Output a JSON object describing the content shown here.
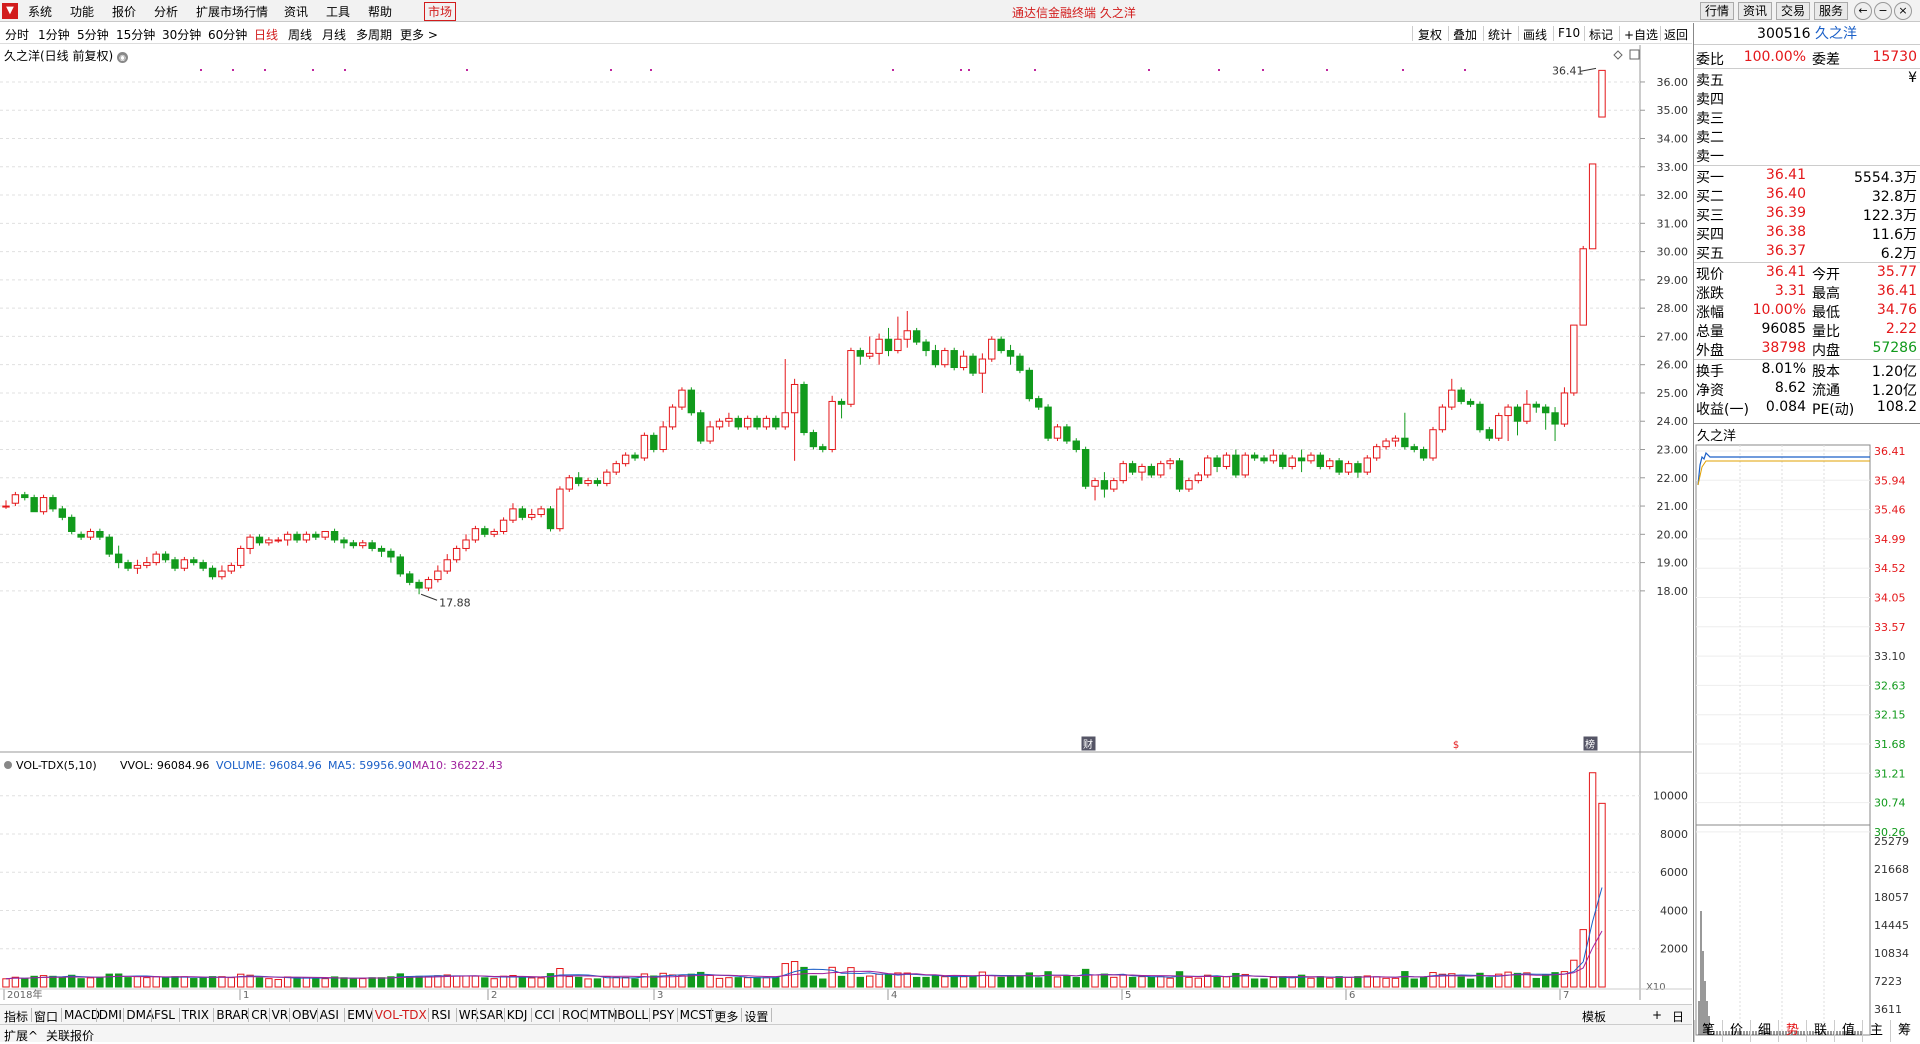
{
  "menu": {
    "items": [
      "系统",
      "功能",
      "报价",
      "分析",
      "扩展市场行情",
      "资讯",
      "工具",
      "帮助",
      "市场"
    ],
    "app_title": "通达信金融终端 久之洋",
    "right_buttons": [
      "行情",
      "资讯",
      "交易",
      "服务"
    ]
  },
  "periods": [
    "分时",
    "1分钟",
    "5分钟",
    "15分钟",
    "30分钟",
    "60分钟",
    "日线",
    "周线",
    "月线",
    "多周期",
    "更多 >"
  ],
  "active_period": "日线",
  "tools": [
    "复权",
    "叠加",
    "统计",
    "画线",
    "F10",
    "标记",
    "+自选",
    "返回"
  ],
  "chart": {
    "title": "久之洋(日线 前复权)",
    "price_axis": [
      "36.00",
      "35.00",
      "34.00",
      "33.00",
      "32.00",
      "31.00",
      "30.00",
      "29.00",
      "28.00",
      "27.00",
      "26.00",
      "25.00",
      "24.00",
      "23.00",
      "22.00",
      "21.00",
      "20.00",
      "19.00",
      "18.00"
    ],
    "high_label": "36.41",
    "low_label": "17.88",
    "date_labels": [
      "2018年",
      "1",
      "2",
      "3",
      "4",
      "5",
      "6",
      "7"
    ],
    "markers": [
      "财",
      "$",
      "榜"
    ],
    "colors": {
      "up": "#e4171a",
      "down": "#119a1c",
      "ma5": "#1a5fc7",
      "ma10": "#a0239e"
    }
  },
  "chart_data": {
    "type": "candlestick",
    "title": "久之洋(日线 前复权)",
    "ylim": [
      17.5,
      36.6
    ],
    "ohlc": [
      [
        21.0,
        21.2,
        20.9,
        21.0
      ],
      [
        21.1,
        21.5,
        21.0,
        21.4
      ],
      [
        21.4,
        21.5,
        21.2,
        21.3
      ],
      [
        21.3,
        21.4,
        20.8,
        20.8
      ],
      [
        20.8,
        21.4,
        20.7,
        21.3
      ],
      [
        21.3,
        21.4,
        20.8,
        20.9
      ],
      [
        20.9,
        21.0,
        20.5,
        20.6
      ],
      [
        20.6,
        20.7,
        20.0,
        20.1
      ],
      [
        20.0,
        20.1,
        19.8,
        19.9
      ],
      [
        19.9,
        20.2,
        19.8,
        20.1
      ],
      [
        20.1,
        20.2,
        19.8,
        19.9
      ],
      [
        19.9,
        20.0,
        19.2,
        19.3
      ],
      [
        19.3,
        19.6,
        18.8,
        19.0
      ],
      [
        19.0,
        19.1,
        18.7,
        18.8
      ],
      [
        18.8,
        19.1,
        18.6,
        18.9
      ],
      [
        18.9,
        19.2,
        18.8,
        19.0
      ],
      [
        19.0,
        19.4,
        18.9,
        19.3
      ],
      [
        19.3,
        19.4,
        19.0,
        19.1
      ],
      [
        19.1,
        19.2,
        18.7,
        18.8
      ],
      [
        18.8,
        19.2,
        18.7,
        19.1
      ],
      [
        19.1,
        19.2,
        18.9,
        19.0
      ],
      [
        19.0,
        19.1,
        18.7,
        18.8
      ],
      [
        18.8,
        18.9,
        18.4,
        18.5
      ],
      [
        18.5,
        18.9,
        18.4,
        18.7
      ],
      [
        18.7,
        19.0,
        18.6,
        18.9
      ],
      [
        18.9,
        19.6,
        18.8,
        19.5
      ],
      [
        19.5,
        20.0,
        19.3,
        19.9
      ],
      [
        19.9,
        20.0,
        19.6,
        19.7
      ],
      [
        19.7,
        19.9,
        19.6,
        19.8
      ],
      [
        19.8,
        19.9,
        19.7,
        19.8
      ],
      [
        19.8,
        20.1,
        19.6,
        20.0
      ],
      [
        20.0,
        20.1,
        19.7,
        19.8
      ],
      [
        19.8,
        20.1,
        19.7,
        20.0
      ],
      [
        20.0,
        20.1,
        19.8,
        19.9
      ],
      [
        19.9,
        20.1,
        19.8,
        20.1
      ],
      [
        20.1,
        20.2,
        19.7,
        19.8
      ],
      [
        19.8,
        19.9,
        19.5,
        19.7
      ],
      [
        19.7,
        19.8,
        19.5,
        19.6
      ],
      [
        19.6,
        19.8,
        19.5,
        19.7
      ],
      [
        19.7,
        19.8,
        19.4,
        19.5
      ],
      [
        19.5,
        19.6,
        19.2,
        19.4
      ],
      [
        19.4,
        19.5,
        19.0,
        19.2
      ],
      [
        19.2,
        19.3,
        18.5,
        18.6
      ],
      [
        18.6,
        18.7,
        18.2,
        18.3
      ],
      [
        18.3,
        18.4,
        17.88,
        18.1
      ],
      [
        18.1,
        18.5,
        18.0,
        18.4
      ],
      [
        18.4,
        18.9,
        18.3,
        18.7
      ],
      [
        18.7,
        19.3,
        18.6,
        19.1
      ],
      [
        19.1,
        19.6,
        19.0,
        19.5
      ],
      [
        19.5,
        20.0,
        19.4,
        19.8
      ],
      [
        19.8,
        20.3,
        19.7,
        20.2
      ],
      [
        20.2,
        20.3,
        19.9,
        20.0
      ],
      [
        20.0,
        20.2,
        19.9,
        20.1
      ],
      [
        20.1,
        20.6,
        20.0,
        20.5
      ],
      [
        20.5,
        21.1,
        20.4,
        20.9
      ],
      [
        20.9,
        21.0,
        20.5,
        20.6
      ],
      [
        20.6,
        20.9,
        20.5,
        20.7
      ],
      [
        20.7,
        21.0,
        20.6,
        20.9
      ],
      [
        20.9,
        21.0,
        20.1,
        20.2
      ],
      [
        20.2,
        21.7,
        20.1,
        21.6
      ],
      [
        21.6,
        22.1,
        21.5,
        22.0
      ],
      [
        22.0,
        22.2,
        21.7,
        21.8
      ],
      [
        21.8,
        22.0,
        21.7,
        21.9
      ],
      [
        21.9,
        22.0,
        21.7,
        21.8
      ],
      [
        21.8,
        22.3,
        21.7,
        22.2
      ],
      [
        22.2,
        22.6,
        22.1,
        22.5
      ],
      [
        22.5,
        22.9,
        22.4,
        22.8
      ],
      [
        22.8,
        22.9,
        22.6,
        22.7
      ],
      [
        22.7,
        23.6,
        22.6,
        23.5
      ],
      [
        23.5,
        23.6,
        22.9,
        23.0
      ],
      [
        23.0,
        24.0,
        22.9,
        23.8
      ],
      [
        23.8,
        24.6,
        23.7,
        24.5
      ],
      [
        24.5,
        25.2,
        24.4,
        25.1
      ],
      [
        25.1,
        25.2,
        24.2,
        24.3
      ],
      [
        24.3,
        24.4,
        23.2,
        23.3
      ],
      [
        23.3,
        24.0,
        23.2,
        23.8
      ],
      [
        23.8,
        24.1,
        23.7,
        24.0
      ],
      [
        24.0,
        24.3,
        23.8,
        24.1
      ],
      [
        24.1,
        24.2,
        23.7,
        23.8
      ],
      [
        23.8,
        24.2,
        23.7,
        24.1
      ],
      [
        24.1,
        24.2,
        23.7,
        23.8
      ],
      [
        23.8,
        24.2,
        23.7,
        24.1
      ],
      [
        24.1,
        24.2,
        23.7,
        23.8
      ],
      [
        23.8,
        26.2,
        23.7,
        24.3
      ],
      [
        24.3,
        25.5,
        22.6,
        25.3
      ],
      [
        25.3,
        25.4,
        23.5,
        23.6
      ],
      [
        23.6,
        23.7,
        23.0,
        23.1
      ],
      [
        23.1,
        23.2,
        22.9,
        23.0
      ],
      [
        23.0,
        24.9,
        22.9,
        24.7
      ],
      [
        24.7,
        24.8,
        24.1,
        24.6
      ],
      [
        24.6,
        26.6,
        24.5,
        26.5
      ],
      [
        26.5,
        26.6,
        26.0,
        26.3
      ],
      [
        26.3,
        27.0,
        26.2,
        26.4
      ],
      [
        26.4,
        27.1,
        26.0,
        26.9
      ],
      [
        26.9,
        27.3,
        26.3,
        26.5
      ],
      [
        26.5,
        27.7,
        26.4,
        26.9
      ],
      [
        26.9,
        27.9,
        26.6,
        27.2
      ],
      [
        27.2,
        27.3,
        26.7,
        26.8
      ],
      [
        26.8,
        26.9,
        26.3,
        26.5
      ],
      [
        26.5,
        26.7,
        25.9,
        26.0
      ],
      [
        26.0,
        26.6,
        25.9,
        26.5
      ],
      [
        26.5,
        26.6,
        25.8,
        25.9
      ],
      [
        25.9,
        26.5,
        25.8,
        26.3
      ],
      [
        26.3,
        26.4,
        25.6,
        25.7
      ],
      [
        25.7,
        26.4,
        25.0,
        26.2
      ],
      [
        26.2,
        27.0,
        26.1,
        26.9
      ],
      [
        26.9,
        27.0,
        26.4,
        26.5
      ],
      [
        26.5,
        26.7,
        26.0,
        26.3
      ],
      [
        26.3,
        26.4,
        25.7,
        25.8
      ],
      [
        25.8,
        25.9,
        24.7,
        24.8
      ],
      [
        24.8,
        24.9,
        24.4,
        24.5
      ],
      [
        24.5,
        24.6,
        23.3,
        23.4
      ],
      [
        23.4,
        23.9,
        23.3,
        23.8
      ],
      [
        23.8,
        23.9,
        23.2,
        23.3
      ],
      [
        23.3,
        23.4,
        22.9,
        23.0
      ],
      [
        23.0,
        23.1,
        21.6,
        21.7
      ],
      [
        21.7,
        22.0,
        21.2,
        21.9
      ],
      [
        21.9,
        22.2,
        21.3,
        21.6
      ],
      [
        21.6,
        22.0,
        21.5,
        21.9
      ],
      [
        21.9,
        22.6,
        21.8,
        22.5
      ],
      [
        22.5,
        22.6,
        22.1,
        22.2
      ],
      [
        22.2,
        22.5,
        21.9,
        22.4
      ],
      [
        22.4,
        22.5,
        22.0,
        22.1
      ],
      [
        22.1,
        22.6,
        22.0,
        22.5
      ],
      [
        22.5,
        22.7,
        22.3,
        22.6
      ],
      [
        22.6,
        22.7,
        21.5,
        21.6
      ],
      [
        21.6,
        22.0,
        21.5,
        21.9
      ],
      [
        21.9,
        22.2,
        21.8,
        22.1
      ],
      [
        22.1,
        22.8,
        22.0,
        22.7
      ],
      [
        22.7,
        22.8,
        22.2,
        22.4
      ],
      [
        22.4,
        22.9,
        22.3,
        22.8
      ],
      [
        22.8,
        23.0,
        22.0,
        22.1
      ],
      [
        22.1,
        22.9,
        22.0,
        22.8
      ],
      [
        22.8,
        22.9,
        22.6,
        22.7
      ],
      [
        22.7,
        22.8,
        22.5,
        22.6
      ],
      [
        22.6,
        23.0,
        22.5,
        22.8
      ],
      [
        22.8,
        22.9,
        22.3,
        22.4
      ],
      [
        22.4,
        22.8,
        22.3,
        22.7
      ],
      [
        22.7,
        23.0,
        22.2,
        22.6
      ],
      [
        22.6,
        22.9,
        22.5,
        22.8
      ],
      [
        22.8,
        22.9,
        22.3,
        22.4
      ],
      [
        22.4,
        22.7,
        22.3,
        22.6
      ],
      [
        22.6,
        22.7,
        22.1,
        22.2
      ],
      [
        22.2,
        22.6,
        22.1,
        22.5
      ],
      [
        22.5,
        22.6,
        22.0,
        22.2
      ],
      [
        22.2,
        22.8,
        22.1,
        22.7
      ],
      [
        22.7,
        23.2,
        22.6,
        23.1
      ],
      [
        23.1,
        23.4,
        23.0,
        23.3
      ],
      [
        23.3,
        23.5,
        23.1,
        23.4
      ],
      [
        23.4,
        24.3,
        23.0,
        23.1
      ],
      [
        23.1,
        23.2,
        22.9,
        23.0
      ],
      [
        23.0,
        23.1,
        22.6,
        22.7
      ],
      [
        22.7,
        23.8,
        22.6,
        23.7
      ],
      [
        23.7,
        24.6,
        23.6,
        24.5
      ],
      [
        24.5,
        25.5,
        24.4,
        25.1
      ],
      [
        25.1,
        25.2,
        24.6,
        24.7
      ],
      [
        24.7,
        24.8,
        24.5,
        24.6
      ],
      [
        24.6,
        24.7,
        23.6,
        23.7
      ],
      [
        23.7,
        23.8,
        23.3,
        23.4
      ],
      [
        23.4,
        24.3,
        23.3,
        24.2
      ],
      [
        24.2,
        24.6,
        23.3,
        24.5
      ],
      [
        24.5,
        24.6,
        23.5,
        24.0
      ],
      [
        24.0,
        25.1,
        23.9,
        24.6
      ],
      [
        24.6,
        24.7,
        24.3,
        24.5
      ],
      [
        24.5,
        24.6,
        23.7,
        24.3
      ],
      [
        24.3,
        24.5,
        23.3,
        23.9
      ],
      [
        23.9,
        25.2,
        23.8,
        25.0
      ],
      [
        25.0,
        27.0,
        24.9,
        27.4
      ],
      [
        27.4,
        30.2,
        27.4,
        30.1
      ],
      [
        30.1,
        33.1,
        30.1,
        33.1
      ],
      [
        34.76,
        36.41,
        34.76,
        36.41
      ]
    ],
    "volume_axis": [
      "10000",
      "8000",
      "6000",
      "4000",
      "2000"
    ],
    "volume_note": "VOL-TDX(5,10) VVOL: 96084.96 VOLUME: 96084.96 MA5: 59956.90 MA10: 36222.43"
  },
  "volume": {
    "legend_name": "VOL-TDX(5,10)",
    "vvol": "VVOL: 96084.96",
    "volume": "VOLUME: 96084.96",
    "ma5": "MA5: 59956.90",
    "ma10": "MA10: 36222.43",
    "axis": [
      "10000",
      "8000",
      "6000",
      "4000",
      "2000"
    ],
    "x10": "X10"
  },
  "indicators": [
    "指标",
    "窗口",
    "MACD",
    "DMI",
    "DMA",
    "FSL",
    "TRIX",
    "BRAR",
    "CR",
    "VR",
    "OBV",
    "ASI",
    "EMV",
    "VOL-TDX",
    "RSI",
    "WR",
    "SAR",
    "KDJ",
    "CCI",
    "ROC",
    "MTM",
    "BOLL",
    "PSY",
    "MCST",
    "更多",
    "设置"
  ],
  "active_indicator": "VOL-TDX",
  "indicator_right": [
    "模板",
    "+",
    "日线"
  ],
  "status": [
    "扩展^",
    "关联报价"
  ],
  "sidebar": {
    "code": "300516",
    "name": "久之洋",
    "weibi": {
      "label": "委比",
      "value": "100.00%",
      "label2": "委差",
      "value2": "15730"
    },
    "sell": [
      {
        "label": "卖五",
        "price": "",
        "vol": "¥"
      },
      {
        "label": "卖四",
        "price": "",
        "vol": ""
      },
      {
        "label": "卖三",
        "price": "",
        "vol": ""
      },
      {
        "label": "卖二",
        "price": "",
        "vol": ""
      },
      {
        "label": "卖一",
        "price": "",
        "vol": ""
      }
    ],
    "buy": [
      {
        "label": "买一",
        "price": "36.41",
        "vol": "5554.3万"
      },
      {
        "label": "买二",
        "price": "36.40",
        "vol": "32.8万"
      },
      {
        "label": "买三",
        "price": "36.39",
        "vol": "122.3万"
      },
      {
        "label": "买四",
        "price": "36.38",
        "vol": "11.6万"
      },
      {
        "label": "买五",
        "price": "36.37",
        "vol": "6.2万"
      }
    ],
    "stats": [
      {
        "l1": "现价",
        "v1": "36.41",
        "c1": "red",
        "l2": "今开",
        "v2": "35.77",
        "c2": "red"
      },
      {
        "l1": "涨跌",
        "v1": "3.31",
        "c1": "red",
        "l2": "最高",
        "v2": "36.41",
        "c2": "red"
      },
      {
        "l1": "涨幅",
        "v1": "10.00%",
        "c1": "red",
        "l2": "最低",
        "v2": "34.76",
        "c2": "red"
      },
      {
        "l1": "总量",
        "v1": "96085",
        "c1": "",
        "l2": "量比",
        "v2": "2.22",
        "c2": "red"
      },
      {
        "l1": "外盘",
        "v1": "38798",
        "c1": "red",
        "l2": "内盘",
        "v2": "57286",
        "c2": "green"
      }
    ],
    "stats2": [
      {
        "l1": "换手",
        "v1": "8.01%",
        "l2": "股本",
        "v2": "1.20亿"
      },
      {
        "l1": "净资",
        "v1": "8.62",
        "l2": "流通",
        "v2": "1.20亿"
      },
      {
        "l1": "收益(一)",
        "v1": "0.084",
        "l2": "PE(动)",
        "v2": "108.2"
      }
    ],
    "mini_title": "久之洋",
    "mini_price_axis": [
      "36.41",
      "35.94",
      "35.46",
      "34.99",
      "34.52",
      "34.05",
      "33.57",
      "33.10",
      "32.63",
      "32.15",
      "31.68",
      "31.21",
      "30.74",
      "30.26"
    ],
    "mini_vol_axis": [
      "25279",
      "21668",
      "18057",
      "14445",
      "10834",
      "7223",
      "3611"
    ],
    "bottom_tabs": [
      "笔",
      "价",
      "细",
      "势",
      "联",
      "值",
      "主",
      "筹"
    ],
    "active_tab": "势"
  }
}
